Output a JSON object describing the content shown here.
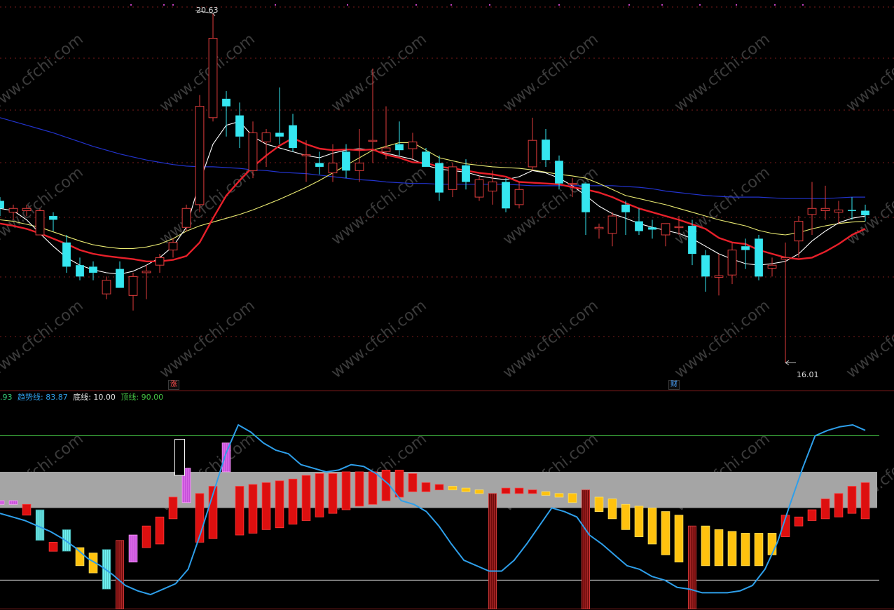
{
  "colors": {
    "background": "#000000",
    "up_candle": "#e03c3c",
    "down_candle": "#35e6f0",
    "ma_white": "#ffffff",
    "ma_red": "#e8202a",
    "ma_yellow": "#eaea72",
    "ma_blue": "#2233cc",
    "grid": "#7a1b1b",
    "band": "#a5a5a5",
    "trend_line": "#2e9fea",
    "top_line": "#44c244",
    "bottom_line": "#e6e6e6"
  },
  "annotations": {
    "high_label": "20.63",
    "low_label": "16.01"
  },
  "markers": [
    "涨",
    "财"
  ],
  "watermark": "www.cfchi.com",
  "indicator_legend": [
    {
      "text": ".93",
      "color": "#35d27a"
    },
    {
      "text": "趋势线: 83.87",
      "color": "#2e9fea"
    },
    {
      "text": "底线: 10.00",
      "color": "#e6e6e6"
    },
    {
      "text": "顶线: 90.00",
      "color": "#44c244"
    }
  ],
  "chart_data": [
    {
      "type": "candlestick",
      "title": "",
      "ylim": [
        15.8,
        20.75
      ],
      "grid": true,
      "ohlc": [
        [
          18.15,
          18.05,
          18.2,
          17.95
        ],
        [
          18.0,
          18.05,
          18.1,
          17.9
        ],
        [
          18.02,
          18.05,
          18.1,
          17.95
        ],
        [
          17.7,
          18.02,
          18.05,
          17.7
        ],
        [
          17.95,
          17.9,
          18.0,
          17.75
        ],
        [
          17.6,
          17.28,
          17.7,
          17.2
        ],
        [
          17.3,
          17.15,
          17.4,
          17.1
        ],
        [
          17.28,
          17.2,
          17.35,
          17.1
        ],
        [
          16.92,
          17.1,
          17.15,
          16.85
        ],
        [
          17.25,
          17.0,
          17.35,
          17.0
        ],
        [
          16.9,
          17.15,
          17.2,
          16.7
        ],
        [
          17.2,
          17.22,
          17.3,
          16.85
        ],
        [
          17.3,
          17.4,
          17.45,
          17.2
        ],
        [
          17.5,
          17.6,
          17.65,
          17.4
        ],
        [
          17.8,
          18.05,
          18.1,
          17.75
        ],
        [
          18.1,
          19.4,
          19.55,
          18.0
        ],
        [
          19.25,
          20.3,
          20.63,
          19.2
        ],
        [
          19.5,
          19.4,
          19.6,
          19.0
        ],
        [
          19.28,
          19.0,
          19.45,
          18.85
        ],
        [
          18.55,
          19.05,
          19.2,
          18.45
        ],
        [
          18.93,
          19.05,
          19.1,
          18.6
        ],
        [
          19.05,
          19.0,
          19.65,
          18.9
        ],
        [
          19.15,
          18.85,
          19.3,
          18.8
        ],
        [
          18.76,
          18.76,
          18.95,
          18.4
        ],
        [
          18.65,
          18.6,
          18.8,
          18.5
        ],
        [
          18.52,
          18.65,
          18.9,
          18.4
        ],
        [
          18.8,
          18.55,
          18.9,
          18.45
        ],
        [
          18.55,
          18.65,
          19.1,
          18.4
        ],
        [
          18.95,
          18.95,
          19.9,
          18.65
        ],
        [
          18.8,
          18.85,
          19.4,
          18.7
        ],
        [
          18.9,
          18.82,
          19.2,
          18.75
        ],
        [
          18.84,
          18.93,
          19.05,
          18.7
        ],
        [
          18.8,
          18.6,
          18.85,
          18.6
        ],
        [
          18.65,
          18.26,
          18.75,
          18.15
        ],
        [
          18.3,
          18.6,
          18.65,
          18.2
        ],
        [
          18.62,
          18.4,
          18.7,
          18.3
        ],
        [
          18.2,
          18.43,
          18.48,
          18.15
        ],
        [
          18.28,
          18.4,
          18.55,
          18.1
        ],
        [
          18.4,
          18.05,
          18.45,
          18.0
        ],
        [
          18.1,
          18.3,
          18.4,
          18.05
        ],
        [
          18.6,
          18.95,
          19.25,
          18.55
        ],
        [
          18.96,
          18.69,
          19.1,
          18.6
        ],
        [
          18.68,
          18.38,
          18.75,
          18.3
        ],
        [
          18.38,
          18.38,
          18.45,
          18.2
        ],
        [
          18.38,
          18.0,
          18.4,
          17.7
        ],
        [
          17.78,
          17.8,
          17.85,
          17.65
        ],
        [
          17.72,
          17.95,
          18.0,
          17.55
        ],
        [
          18.1,
          18.0,
          18.15,
          17.7
        ],
        [
          17.88,
          17.75,
          18.05,
          17.7
        ],
        [
          17.8,
          17.77,
          17.9,
          17.65
        ],
        [
          17.7,
          17.85,
          17.85,
          17.55
        ],
        [
          17.8,
          17.81,
          17.95,
          17.7
        ],
        [
          17.82,
          17.45,
          17.9,
          17.3
        ],
        [
          17.43,
          17.15,
          17.5,
          16.95
        ],
        [
          17.14,
          17.16,
          17.45,
          16.9
        ],
        [
          17.17,
          17.5,
          17.6,
          17.05
        ],
        [
          17.55,
          17.5,
          17.65,
          17.25
        ],
        [
          17.65,
          17.15,
          17.7,
          17.1
        ],
        [
          17.26,
          17.3,
          17.4,
          17.15
        ],
        [
          17.38,
          17.4,
          17.6,
          16.01
        ],
        [
          17.62,
          17.88,
          17.95,
          17.4
        ],
        [
          17.97,
          18.05,
          18.4,
          17.7
        ],
        [
          18.02,
          18.05,
          18.35,
          17.9
        ],
        [
          18.0,
          18.03,
          18.15,
          17.85
        ],
        [
          18.03,
          18.02,
          18.2,
          17.9
        ],
        [
          18.02,
          17.96,
          18.1,
          17.88
        ]
      ],
      "ma": {
        "white": [
          18.05,
          18.02,
          17.9,
          17.72,
          17.55,
          17.4,
          17.3,
          17.24,
          17.2,
          17.18,
          17.22,
          17.3,
          17.4,
          17.55,
          17.8,
          18.4,
          18.9,
          19.15,
          19.2,
          19.0,
          18.9,
          18.85,
          18.8,
          18.75,
          18.72,
          18.78,
          18.82,
          18.84,
          18.82,
          18.78,
          18.74,
          18.7,
          18.62,
          18.57,
          18.55,
          18.53,
          18.48,
          18.45,
          18.43,
          18.47,
          18.55,
          18.52,
          18.45,
          18.35,
          18.22,
          18.08,
          17.98,
          17.92,
          17.85,
          17.8,
          17.76,
          17.72,
          17.65,
          17.55,
          17.45,
          17.38,
          17.32,
          17.3,
          17.32,
          17.35,
          17.45,
          17.62,
          17.75,
          17.86,
          17.92,
          17.95
        ],
        "red": [
          17.85,
          17.82,
          17.78,
          17.72,
          17.65,
          17.58,
          17.5,
          17.45,
          17.42,
          17.4,
          17.38,
          17.35,
          17.35,
          17.37,
          17.42,
          17.6,
          17.92,
          18.22,
          18.42,
          18.6,
          18.75,
          18.88,
          18.98,
          18.9,
          18.84,
          18.82,
          18.83,
          18.82,
          18.83,
          18.76,
          18.72,
          18.66,
          18.65,
          18.6,
          18.58,
          18.55,
          18.52,
          18.5,
          18.47,
          18.4,
          18.39,
          18.38,
          18.37,
          18.33,
          18.3,
          18.26,
          18.2,
          18.12,
          18.05,
          18.0,
          17.95,
          17.9,
          17.84,
          17.78,
          17.66,
          17.6,
          17.58,
          17.5,
          17.45,
          17.4,
          17.38,
          17.4,
          17.48,
          17.58,
          17.7,
          17.78
        ],
        "yellow": [
          17.9,
          17.88,
          17.84,
          17.8,
          17.74,
          17.68,
          17.62,
          17.57,
          17.54,
          17.52,
          17.52,
          17.54,
          17.58,
          17.65,
          17.75,
          17.82,
          17.87,
          17.92,
          17.97,
          18.03,
          18.1,
          18.17,
          18.25,
          18.33,
          18.42,
          18.52,
          18.62,
          18.72,
          18.82,
          18.87,
          18.92,
          18.92,
          18.82,
          18.72,
          18.68,
          18.64,
          18.62,
          18.6,
          18.59,
          18.58,
          18.56,
          18.53,
          18.5,
          18.48,
          18.45,
          18.38,
          18.3,
          18.22,
          18.18,
          18.14,
          18.1,
          18.05,
          18.0,
          17.95,
          17.9,
          17.86,
          17.82,
          17.76,
          17.72,
          17.7,
          17.73,
          17.78,
          17.82,
          17.85,
          17.87,
          17.88
        ],
        "blue": [
          19.25,
          19.2,
          19.15,
          19.1,
          19.05,
          18.99,
          18.93,
          18.87,
          18.82,
          18.77,
          18.73,
          18.69,
          18.66,
          18.63,
          18.61,
          18.6,
          18.6,
          18.59,
          18.58,
          18.56,
          18.55,
          18.53,
          18.52,
          18.51,
          18.49,
          18.47,
          18.45,
          18.43,
          18.42,
          18.4,
          18.39,
          18.38,
          18.38,
          18.37,
          18.37,
          18.37,
          18.37,
          18.37,
          18.37,
          18.36,
          18.35,
          18.35,
          18.35,
          18.35,
          18.35,
          18.35,
          18.35,
          18.34,
          18.33,
          18.31,
          18.28,
          18.26,
          18.24,
          18.22,
          18.21,
          18.2,
          18.2,
          18.2,
          18.19,
          18.18,
          18.18,
          18.18,
          18.18,
          18.19,
          18.2,
          18.2
        ]
      }
    },
    {
      "type": "bar",
      "title": "",
      "ylim": [
        -5,
        110
      ],
      "band": [
        50,
        70
      ],
      "lines": {
        "top": 90,
        "bottom": 10
      },
      "trend": [
        47,
        45,
        43,
        40,
        37,
        33,
        28,
        22,
        18,
        13,
        7,
        4,
        2,
        5,
        8,
        16,
        36,
        58,
        80,
        96,
        92,
        86,
        82,
        80,
        74,
        72,
        70,
        71,
        74,
        73,
        69,
        63,
        54,
        52,
        48,
        40,
        30,
        21,
        18,
        15,
        15,
        21,
        30,
        40,
        50,
        48,
        45,
        35,
        30,
        24,
        18,
        16,
        12,
        10,
        6,
        5,
        3,
        3,
        3,
        4,
        7,
        16,
        31,
        52,
        72,
        90,
        93,
        95,
        96,
        93
      ],
      "hist": [
        {
          "lo": 52,
          "hi": 54,
          "c": "m"
        },
        {
          "lo": 52,
          "hi": 54,
          "c": "m"
        },
        {
          "lo": 46,
          "hi": 52,
          "c": "r"
        },
        {
          "lo": 32,
          "hi": 49,
          "c": "c"
        },
        {
          "lo": 26,
          "hi": 31,
          "c": "r"
        },
        {
          "lo": 26,
          "hi": 38,
          "c": "c"
        },
        {
          "lo": 18,
          "hi": 28,
          "c": "y"
        },
        {
          "lo": 14,
          "hi": 25,
          "c": "y"
        },
        {
          "lo": 5,
          "hi": 27,
          "c": "c"
        },
        {
          "lo": -6,
          "hi": 32,
          "c": "s"
        },
        {
          "lo": 20,
          "hi": 35,
          "c": "m"
        },
        {
          "lo": 28,
          "hi": 40,
          "c": "r"
        },
        {
          "lo": 30,
          "hi": 45,
          "c": "r"
        },
        {
          "lo": 44,
          "hi": 56,
          "c": "r"
        },
        {
          "lo": 53,
          "hi": 72,
          "c": "m"
        },
        {
          "lo": 31,
          "hi": 58,
          "c": "r"
        },
        {
          "lo": 33,
          "hi": 62,
          "c": "r"
        },
        {
          "lo": 70,
          "hi": 86,
          "c": "m"
        },
        {
          "lo": 35,
          "hi": 62,
          "c": "r"
        },
        {
          "lo": 36,
          "hi": 63,
          "c": "r"
        },
        {
          "lo": 38,
          "hi": 64,
          "c": "r"
        },
        {
          "lo": 39,
          "hi": 65,
          "c": "r"
        },
        {
          "lo": 41,
          "hi": 66,
          "c": "r"
        },
        {
          "lo": 43,
          "hi": 68,
          "c": "r"
        },
        {
          "lo": 45,
          "hi": 69,
          "c": "r"
        },
        {
          "lo": 47,
          "hi": 69,
          "c": "r"
        },
        {
          "lo": 49,
          "hi": 70,
          "c": "r"
        },
        {
          "lo": 51,
          "hi": 70,
          "c": "r"
        },
        {
          "lo": 52,
          "hi": 70,
          "c": "r"
        },
        {
          "lo": 54,
          "hi": 71,
          "c": "r"
        },
        {
          "lo": 56,
          "hi": 71,
          "c": "r"
        },
        {
          "lo": 59,
          "hi": 69,
          "c": "r"
        },
        {
          "lo": 59,
          "hi": 64,
          "c": "r"
        },
        {
          "lo": 60,
          "hi": 63,
          "c": "r"
        },
        {
          "lo": 60,
          "hi": 62,
          "c": "y"
        },
        {
          "lo": 59,
          "hi": 61,
          "c": "y"
        },
        {
          "lo": 58,
          "hi": 60,
          "c": "y"
        },
        {
          "lo": -6,
          "hi": 58,
          "c": "s"
        },
        {
          "lo": 58,
          "hi": 61,
          "c": "r"
        },
        {
          "lo": 58,
          "hi": 61,
          "c": "r"
        },
        {
          "lo": 58,
          "hi": 60,
          "c": "r"
        },
        {
          "lo": 57,
          "hi": 59,
          "c": "y"
        },
        {
          "lo": 56,
          "hi": 58,
          "c": "y"
        },
        {
          "lo": 53,
          "hi": 58,
          "c": "y"
        },
        {
          "lo": -6,
          "hi": 60,
          "c": "s"
        },
        {
          "lo": 48,
          "hi": 56,
          "c": "y"
        },
        {
          "lo": 44,
          "hi": 55,
          "c": "y"
        },
        {
          "lo": 38,
          "hi": 52,
          "c": "y"
        },
        {
          "lo": 34,
          "hi": 51,
          "c": "y"
        },
        {
          "lo": 30,
          "hi": 50,
          "c": "y"
        },
        {
          "lo": 24,
          "hi": 48,
          "c": "y"
        },
        {
          "lo": 20,
          "hi": 46,
          "c": "y"
        },
        {
          "lo": -6,
          "hi": 40,
          "c": "s"
        },
        {
          "lo": 18,
          "hi": 40,
          "c": "y"
        },
        {
          "lo": 18,
          "hi": 38,
          "c": "y"
        },
        {
          "lo": 18,
          "hi": 37,
          "c": "y"
        },
        {
          "lo": 18,
          "hi": 36,
          "c": "y"
        },
        {
          "lo": 18,
          "hi": 36,
          "c": "y"
        },
        {
          "lo": 24,
          "hi": 36,
          "c": "y"
        },
        {
          "lo": 34,
          "hi": 46,
          "c": "r"
        },
        {
          "lo": 40,
          "hi": 45,
          "c": "r"
        },
        {
          "lo": 43,
          "hi": 49,
          "c": "r"
        },
        {
          "lo": 44,
          "hi": 55,
          "c": "r"
        },
        {
          "lo": 45,
          "hi": 58,
          "c": "r"
        },
        {
          "lo": 47,
          "hi": 62,
          "c": "r"
        },
        {
          "lo": 44,
          "hi": 64,
          "c": "r"
        }
      ]
    }
  ]
}
